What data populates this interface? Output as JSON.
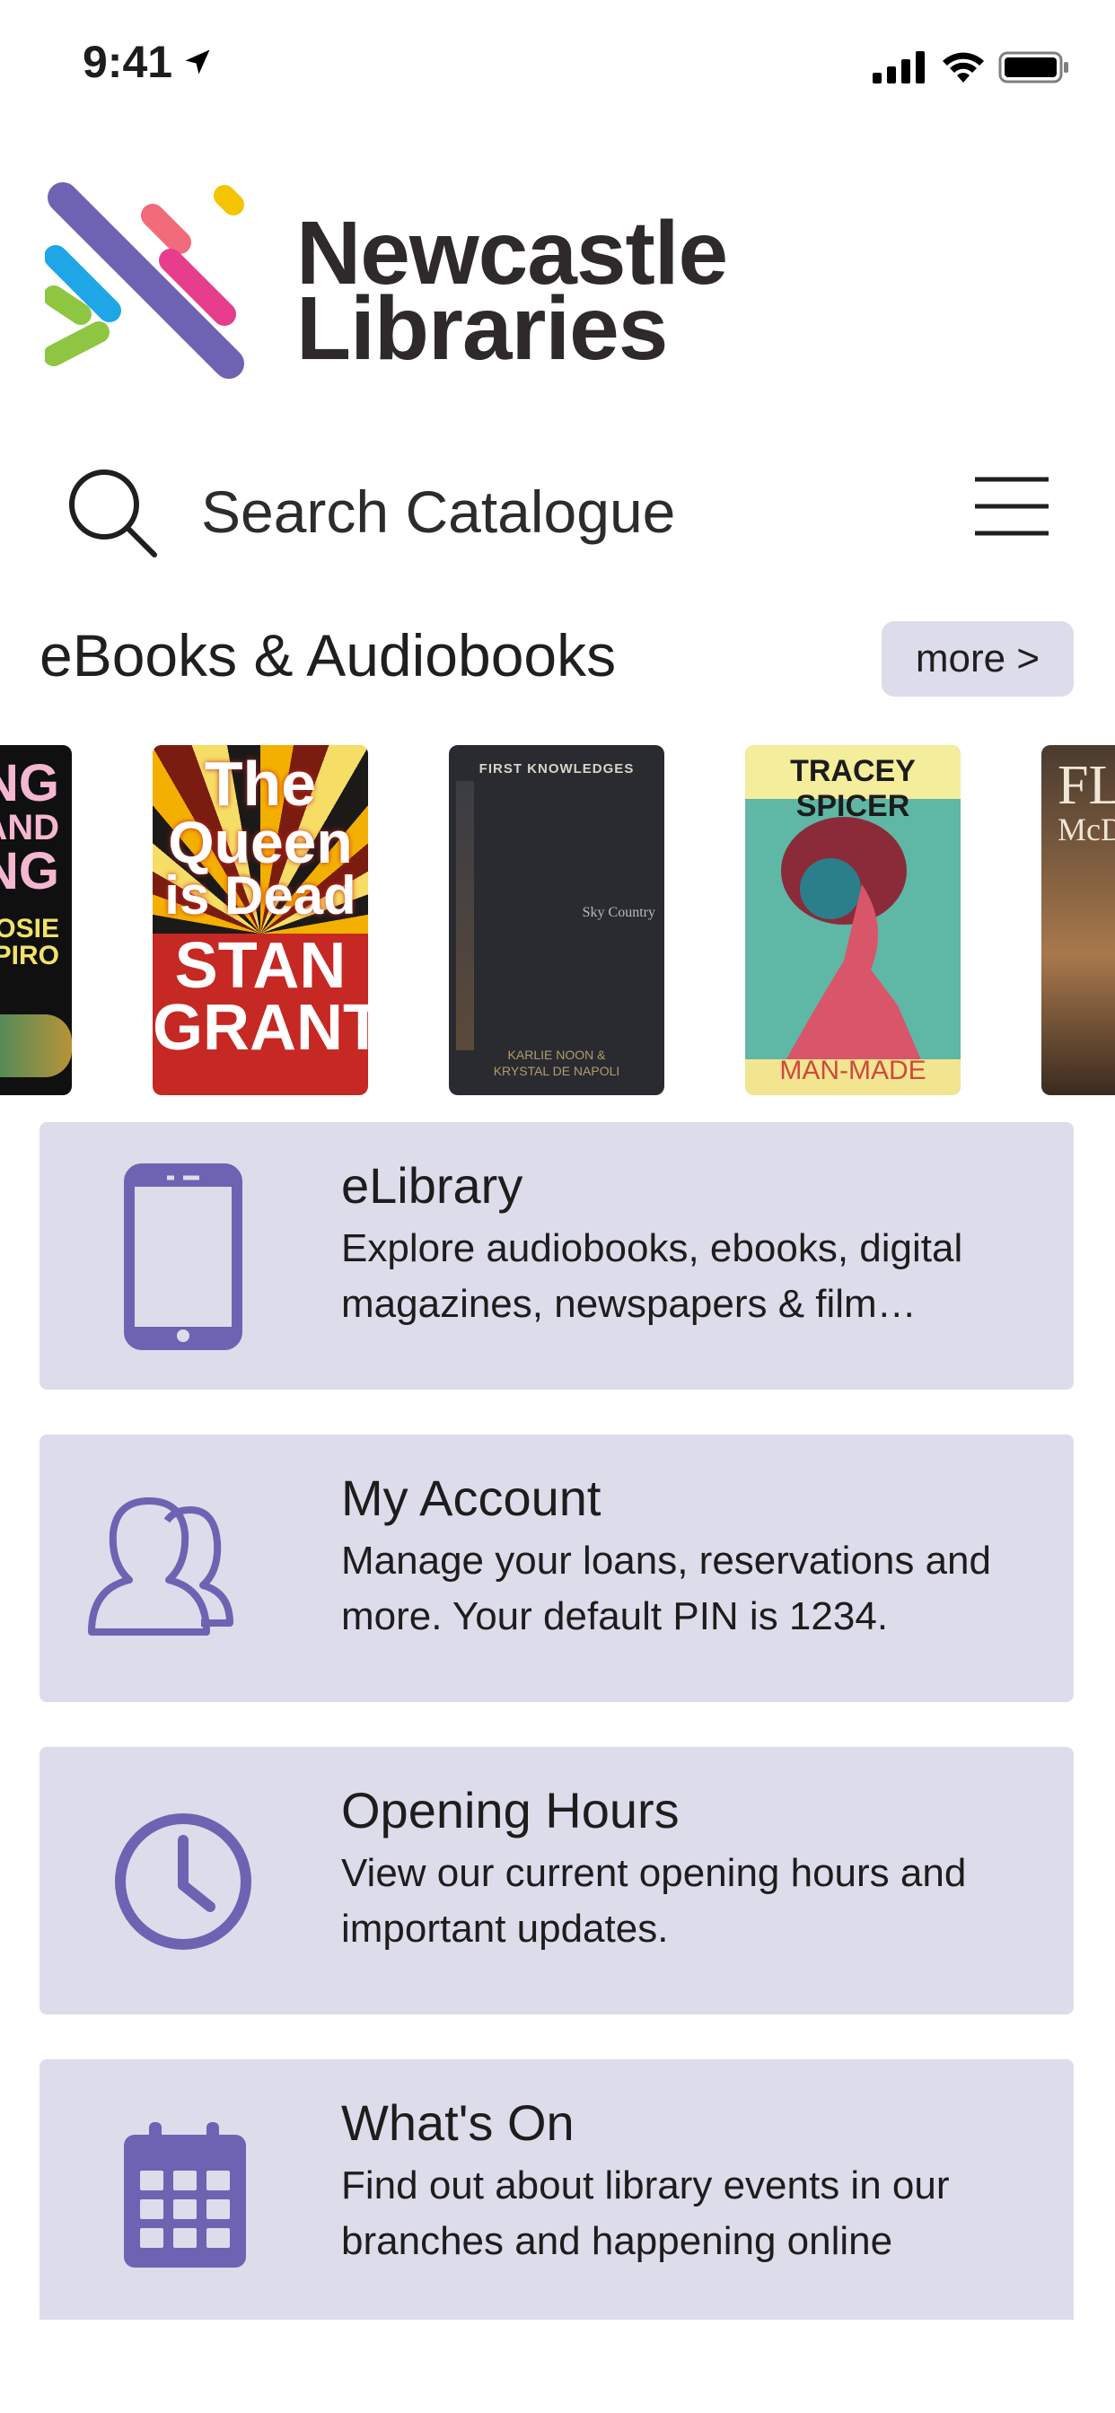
{
  "status_bar": {
    "time": "9:41"
  },
  "logo": {
    "line1": "Newcastle",
    "line2": "Libraries"
  },
  "search": {
    "placeholder": "Search Catalogue"
  },
  "section": {
    "title": "eBooks & Audiobooks",
    "more_label": "more >"
  },
  "books": [
    {
      "title_lines": [
        "ING",
        "UL AND",
        "ING",
        "JOSIE",
        "HAPIRO"
      ]
    },
    {
      "title_lines": [
        "The",
        "Queen",
        "is Dead",
        "STAN",
        "GRANT"
      ]
    },
    {
      "title_lines": [
        "FIRST KNOWLEDGES",
        "Sky Country",
        "KARLIE NOON &",
        "KRYSTAL DE NAPOLI"
      ]
    },
    {
      "title_lines": [
        "TRACEY SPICER",
        "MAN-MADE"
      ]
    },
    {
      "title_lines": [
        "FL",
        "McD"
      ]
    }
  ],
  "cards": [
    {
      "title": "eLibrary",
      "desc": "Explore audiobooks, ebooks, digital magazines, newspapers & film…",
      "icon": "phone-icon"
    },
    {
      "title": "My Account",
      "desc": "Manage your loans, reservations and more. Your default PIN is 1234.",
      "icon": "users-icon"
    },
    {
      "title": "Opening Hours",
      "desc": "View our current opening hours and important updates.",
      "icon": "clock-icon"
    },
    {
      "title": "What's On",
      "desc": "Find out about library events in our branches and happening online",
      "icon": "calendar-icon"
    }
  ],
  "colors": {
    "accent": "#6e63b2",
    "card_bg": "#dddcea"
  }
}
